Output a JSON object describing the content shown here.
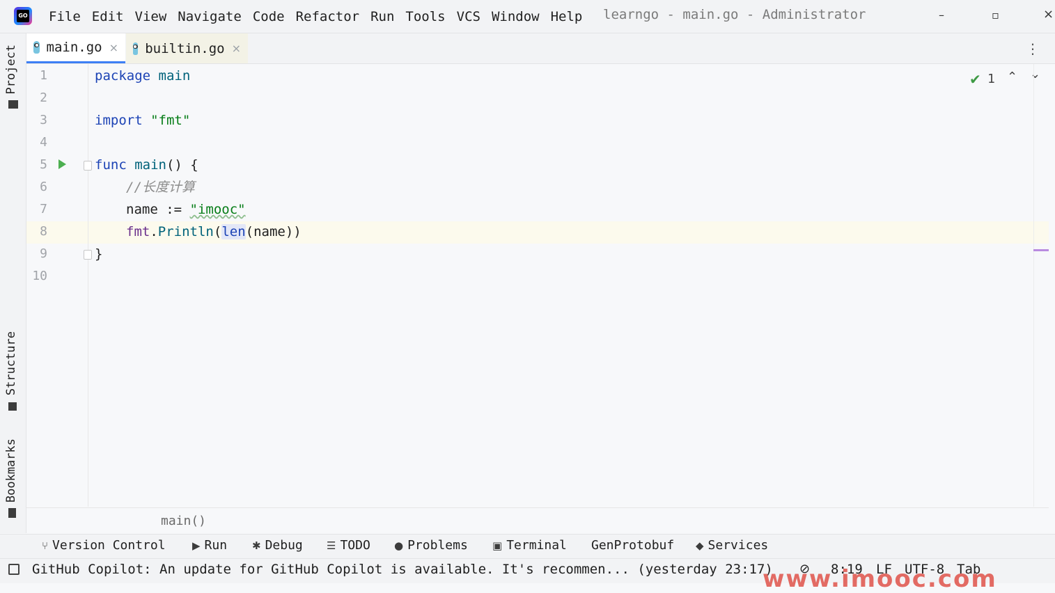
{
  "menu": [
    "File",
    "Edit",
    "View",
    "Navigate",
    "Code",
    "Refactor",
    "Run",
    "Tools",
    "VCS",
    "Window",
    "Help"
  ],
  "window_title": "learngo - main.go - Administrator",
  "logo_text": "GO",
  "window_controls": {
    "minimize": "–",
    "restore": "▫",
    "close": "×"
  },
  "left_tools": {
    "project": "Project",
    "structure": "Structure",
    "bookmarks": "Bookmarks"
  },
  "tabs": [
    {
      "label": "main.go",
      "active": true
    },
    {
      "label": "builtin.go",
      "active": false
    }
  ],
  "tab_close": "×",
  "tab_menu": "⋮",
  "line_numbers": [
    "1",
    "2",
    "3",
    "4",
    "5",
    "6",
    "7",
    "8",
    "9",
    "10"
  ],
  "code": {
    "l1_kw": "package",
    "l1_name": "main",
    "l3_kw": "import",
    "l3_str": "\"fmt\"",
    "l5_kw": "func",
    "l5_name": "main",
    "l5_rest": "() {",
    "l6_comment": "//长度计算",
    "l7_ident": "name",
    "l7_op": " := ",
    "l7_str": "\"imooc\"",
    "l8_pkg": "fmt",
    "l8_dot": ".",
    "l8_method": "Println",
    "l8_open": "(",
    "l8_len": "len",
    "l8_rest": "(name))",
    "l9_close": "}"
  },
  "inspection": {
    "ok_icon": "✔",
    "count": "1",
    "up": "⌃",
    "down": "⌄"
  },
  "breadcrumb": "main()",
  "tool_windows": [
    {
      "label": "Version Control",
      "icon": "⑂"
    },
    {
      "label": "Run",
      "icon": "▶"
    },
    {
      "label": "Debug",
      "icon": "✱"
    },
    {
      "label": "TODO",
      "icon": "☰"
    },
    {
      "label": "Problems",
      "icon": "●"
    },
    {
      "label": "Terminal",
      "icon": "▣"
    },
    {
      "label": "GenProtobuf",
      "icon": ""
    },
    {
      "label": "Services",
      "icon": "◆"
    }
  ],
  "status": {
    "message": "GitHub Copilot: An update for GitHub Copilot is available. It's recommen... (yesterday 23:17)",
    "position": "8:19",
    "line_sep": "LF",
    "encoding": "UTF-8",
    "indent": "Tab"
  },
  "watermark": "www.imooc.com"
}
